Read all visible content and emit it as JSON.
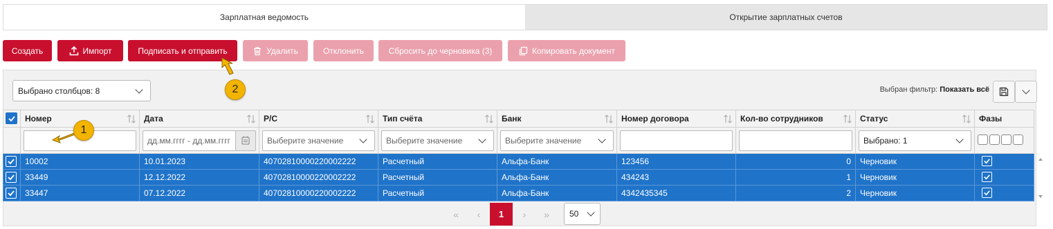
{
  "tabs": [
    "Зарплатная ведомость",
    "Открытие зарплатных счетов"
  ],
  "toolbar": {
    "create": "Создать",
    "import": "Импорт",
    "sign_send": "Подписать и отправить",
    "delete": "Удалить",
    "reject": "Отклонить",
    "reset_draft": "Сбросить до черновика (3)",
    "copy_doc": "Копировать документ"
  },
  "columns_select": "Выбрано столбцов: 8",
  "filter": {
    "label": "Выбран фильтр:",
    "value": "Показать всё"
  },
  "table": {
    "headers": [
      "Номер",
      "Дата",
      "Р/С",
      "Тип счёта",
      "Банк",
      "Номер договора",
      "Кол-во сотрудников",
      "Статус",
      "Фазы"
    ],
    "filters": {
      "date_placeholder": "дд.мм.гггг - дд.мм.гггг",
      "select_placeholder": "Выберите значение",
      "status_value": "Выбрано: 1"
    },
    "rows": [
      {
        "number": "10002",
        "date": "10.01.2023",
        "account": "40702810000220002222",
        "type": "Расчетный",
        "bank": "Альфа-Банк",
        "contract": "123456",
        "employees": "0",
        "status": "Черновик"
      },
      {
        "number": "33449",
        "date": "12.12.2022",
        "account": "40702810000220002222",
        "type": "Расчетный",
        "bank": "Альфа-Банк",
        "contract": "434243",
        "employees": "1",
        "status": "Черновик"
      },
      {
        "number": "33447",
        "date": "07.12.2022",
        "account": "40702810000220002222",
        "type": "Расчетный",
        "bank": "Альфа-Банк",
        "contract": "4342435345",
        "employees": "2",
        "status": "Черновик"
      }
    ]
  },
  "pagination": {
    "first": "«",
    "prev": "‹",
    "current": "1",
    "next": "›",
    "last": "»",
    "page_size": "50"
  },
  "annotations": [
    "1",
    "2"
  ],
  "colors": {
    "accent": "#c8102e",
    "selection": "#1f73c9",
    "badge": "#f3b400"
  }
}
